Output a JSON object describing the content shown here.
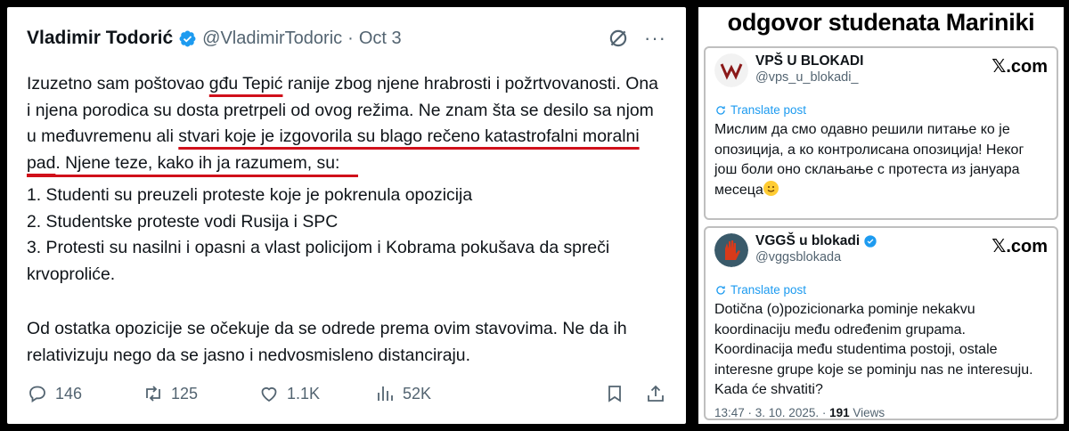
{
  "left_tweet": {
    "author": "Vladimir Todorić",
    "handle": "@VladimirTodoric",
    "separator": "·",
    "date": "Oct 3",
    "more": "···",
    "body": {
      "p1_a": "Izuzetno sam poštovao ",
      "p1_ul1": "gđu Tepić",
      "p1_b": " ranije zbog njene hrabrosti i požrtvovanosti. Ona i njena porodica su dosta pretrpeli od ovog režima. Ne znam šta se desilo sa njom u međuvremenu ali ",
      "p1_ul2": "stvari koje je izgovorila su blago rečeno katastrofalni moralni pad",
      "p1_c": ". Njene teze, kako ih ja razumem, su:",
      "list": [
        "1. Studenti su preuzeli proteste koje je pokrenula opozicija",
        "2. Studentske proteste vodi Rusija i SPC",
        "3. Protesti su nasilni i opasni a vlast policijom i Kobrama pokušava da spreči krvoproliće."
      ],
      "p2": "Od ostatka opozicije se očekuje da se odrede prema ovim stavovima. Ne da ih relativizuju nego da se jasno i nedvosmisleno distanciraju."
    },
    "stats": {
      "replies": "146",
      "reposts": "125",
      "likes": "1.1K",
      "views": "52K"
    }
  },
  "right_panel": {
    "title": "odgovor studenata Mariniki",
    "cards": [
      {
        "name": "VPŠ U BLOKADI",
        "handle": "@vps_u_blokadi_",
        "brand": "𝕏.com",
        "translate": "Translate post",
        "text": "Мислим да смо одавно решили питање ко је опозиција, а ко контролисана опозиција! Неког још боли оно склањање с протеста из јануара месеца"
      },
      {
        "name": "VGGŠ u blokadi",
        "handle": "@vggsblokada",
        "brand": "𝕏.com",
        "translate": "Translate post",
        "text": "Dotična (o)pozicionarka pominje nekakvu koordinaciju među određenim grupama. Koordinacija među studentima postoji, ostale interesne grupe koje se pominju nas ne interesuju. Kada će shvatiti?",
        "meta_time": "13:47 · 3. 10. 2025. · ",
        "meta_views": "191",
        "meta_views_label": " Views"
      }
    ]
  },
  "colors": {
    "accent_blue": "#1d9bf0",
    "underline_red": "#d0101a",
    "muted": "#536471"
  },
  "icons": [
    "verified-badge-icon",
    "grok-icon",
    "more-icon",
    "reply-icon",
    "repost-icon",
    "like-icon",
    "views-icon",
    "bookmark-icon",
    "share-icon",
    "translate-icon",
    "smile-emoji-icon"
  ]
}
